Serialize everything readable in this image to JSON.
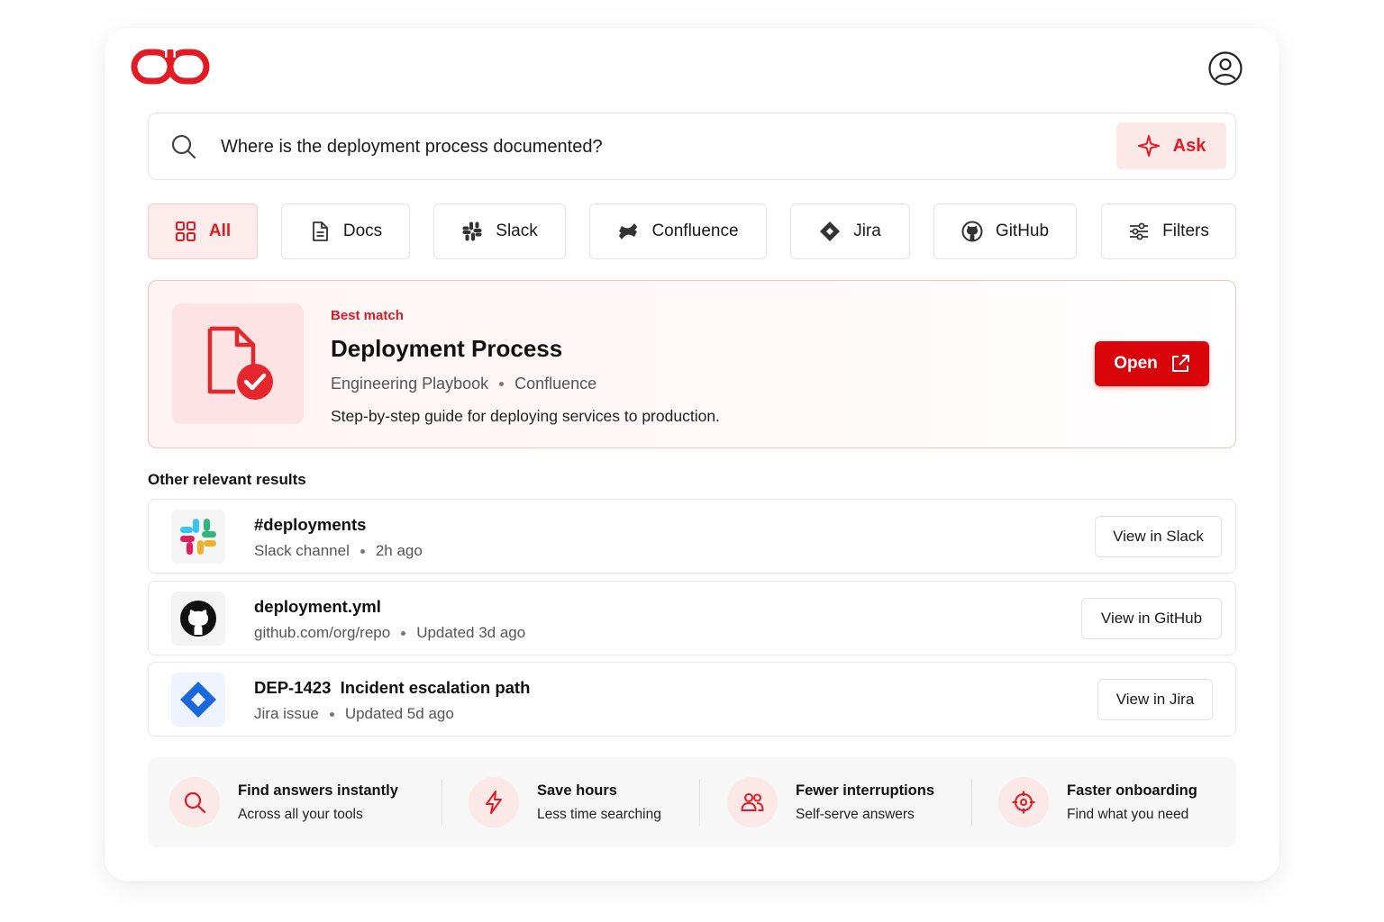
{
  "colors": {
    "accent": "#e01b24",
    "accent_strong": "#d9050b",
    "accent_soft": "#fde8e8"
  },
  "header": {
    "logo_icon": "link-logo-icon",
    "avatar_icon": "user-circle-icon"
  },
  "search": {
    "value": "Where is the deployment process documented?",
    "ask_label": "Ask"
  },
  "filters": {
    "all": "All",
    "docs": "Docs",
    "slack": "Slack",
    "confluence": "Confluence",
    "jira": "Jira",
    "github": "GitHub",
    "more": "Filters"
  },
  "best_match": {
    "label": "Best match",
    "title": "Deployment Process",
    "source": "Engineering Playbook",
    "app": "Confluence",
    "description": "Step-by-step guide for deploying services to production.",
    "open_label": "Open"
  },
  "other_results": {
    "title": "Other relevant results",
    "items": [
      {
        "title": "#deployments",
        "meta1": "Slack channel",
        "meta2": "2h ago",
        "action": "View in Slack"
      },
      {
        "title": "deployment.yml",
        "meta1": "github.com/org/repo",
        "meta2": "Updated 3d ago",
        "action": "View in GitHub"
      },
      {
        "title": "DEP-1423  Incident escalation path",
        "meta1": "Jira issue",
        "meta2": "Updated 5d ago",
        "action": "View in Jira"
      }
    ]
  },
  "features": [
    {
      "title": "Find answers instantly",
      "sub": "Across all your tools"
    },
    {
      "title": "Save hours",
      "sub": "Less time searching"
    },
    {
      "title": "Fewer interruptions",
      "sub": "Self-serve answers"
    },
    {
      "title": "Faster onboarding",
      "sub": "Find what you need"
    }
  ]
}
